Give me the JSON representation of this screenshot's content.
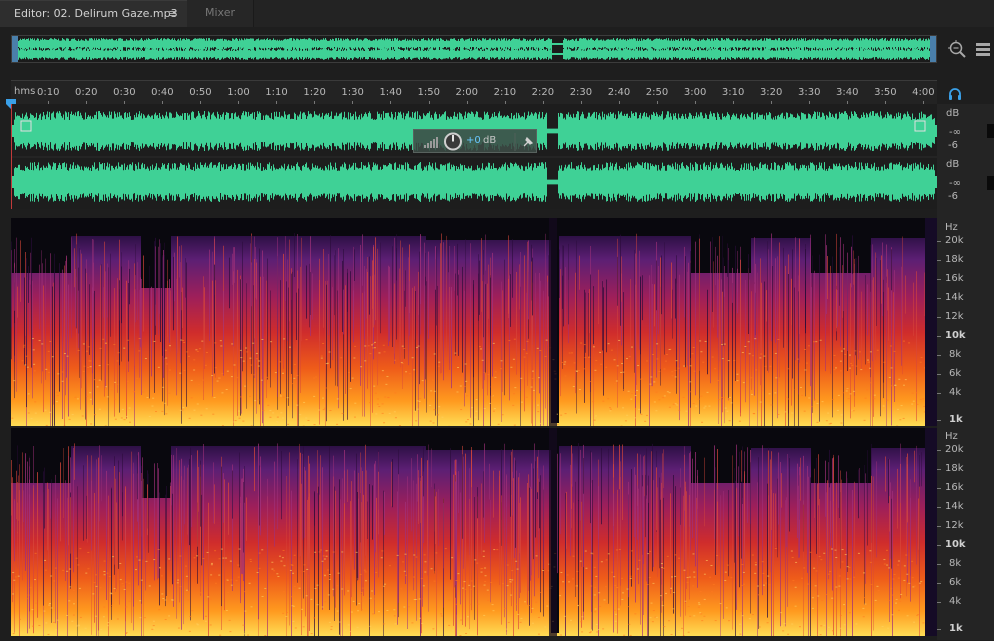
{
  "tabs": {
    "editor_label": "Editor: 02. Delirum Gaze.mp3",
    "menu_glyph": "≡",
    "mixer_label": "Mixer"
  },
  "ruler": {
    "unit_label": "hms",
    "ticks": [
      "0:10",
      "0:20",
      "0:30",
      "0:40",
      "0:50",
      "1:00",
      "1:10",
      "1:20",
      "1:30",
      "1:40",
      "1:50",
      "2:00",
      "2:10",
      "2:20",
      "2:30",
      "2:40",
      "2:50",
      "3:00",
      "3:10",
      "3:20",
      "3:30",
      "3:40",
      "3:50",
      "4:00"
    ]
  },
  "amplitude_scale": {
    "unit": "dB",
    "values": [
      "-∞",
      "-6"
    ]
  },
  "hud": {
    "value": "+0",
    "unit": "dB"
  },
  "frequency_scale": {
    "unit": "Hz",
    "labels": [
      "20k",
      "18k",
      "16k",
      "14k",
      "12k",
      "10k",
      "8k",
      "6k",
      "4k",
      "1k"
    ]
  },
  "colors": {
    "waveform": "#3fd196",
    "background": "#1e1e1e",
    "accent": "#3aa0e8"
  },
  "icons": {
    "zoom": "zoom-icon",
    "list": "list-icon",
    "headphones": "headphone-icon",
    "volume": "volume-knob-icon",
    "pin": "pin-icon"
  }
}
